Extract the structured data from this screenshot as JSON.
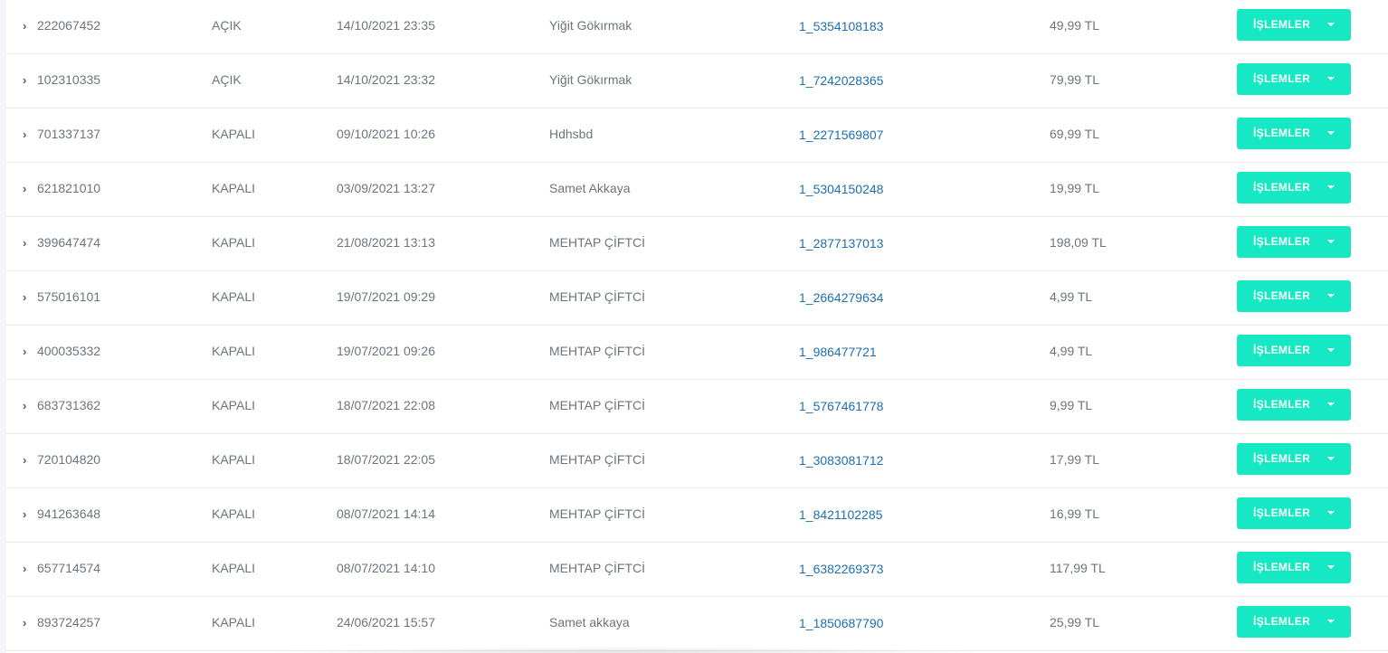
{
  "table": {
    "action_label": "İŞLEMLER",
    "rows": [
      {
        "id": "222067452",
        "status": "AÇIK",
        "date": "14/10/2021 23:35",
        "customer": "Yiğit Gökırmak",
        "reference": "1_5354108183",
        "amount": "49,99 TL"
      },
      {
        "id": "102310335",
        "status": "AÇIK",
        "date": "14/10/2021 23:32",
        "customer": "Yiğit Gökırmak",
        "reference": "1_7242028365",
        "amount": "79,99 TL"
      },
      {
        "id": "701337137",
        "status": "KAPALI",
        "date": "09/10/2021 10:26",
        "customer": "Hdhsbd",
        "reference": "1_2271569807",
        "amount": "69,99 TL"
      },
      {
        "id": "621821010",
        "status": "KAPALI",
        "date": "03/09/2021 13:27",
        "customer": "Samet Akkaya",
        "reference": "1_5304150248",
        "amount": "19,99 TL"
      },
      {
        "id": "399647474",
        "status": "KAPALI",
        "date": "21/08/2021 13:13",
        "customer": "MEHTAP ÇİFTCİ",
        "reference": "1_2877137013",
        "amount": "198,09 TL"
      },
      {
        "id": "575016101",
        "status": "KAPALI",
        "date": "19/07/2021 09:29",
        "customer": "MEHTAP ÇİFTCİ",
        "reference": "1_2664279634",
        "amount": "4,99 TL"
      },
      {
        "id": "400035332",
        "status": "KAPALI",
        "date": "19/07/2021 09:26",
        "customer": "MEHTAP ÇİFTCİ",
        "reference": "1_986477721",
        "amount": "4,99 TL"
      },
      {
        "id": "683731362",
        "status": "KAPALI",
        "date": "18/07/2021 22:08",
        "customer": "MEHTAP ÇİFTCİ",
        "reference": "1_5767461778",
        "amount": "9,99 TL"
      },
      {
        "id": "720104820",
        "status": "KAPALI",
        "date": "18/07/2021 22:05",
        "customer": "MEHTAP ÇİFTCİ",
        "reference": "1_3083081712",
        "amount": "17,99 TL"
      },
      {
        "id": "941263648",
        "status": "KAPALI",
        "date": "08/07/2021 14:14",
        "customer": "MEHTAP ÇİFTCİ",
        "reference": "1_8421102285",
        "amount": "16,99 TL"
      },
      {
        "id": "657714574",
        "status": "KAPALI",
        "date": "08/07/2021 14:10",
        "customer": "MEHTAP ÇİFTCİ",
        "reference": "1_6382269373",
        "amount": "117,99 TL"
      },
      {
        "id": "893724257",
        "status": "KAPALI",
        "date": "24/06/2021 15:57",
        "customer": "Samet akkaya",
        "reference": "1_1850687790",
        "amount": "25,99 TL"
      }
    ]
  },
  "icons": {
    "expand": "chevron-right-icon",
    "dropdown": "caret-down-icon"
  },
  "colors": {
    "action_button": "#15e8c3",
    "link": "#1f6fae",
    "text": "#6c757d"
  }
}
